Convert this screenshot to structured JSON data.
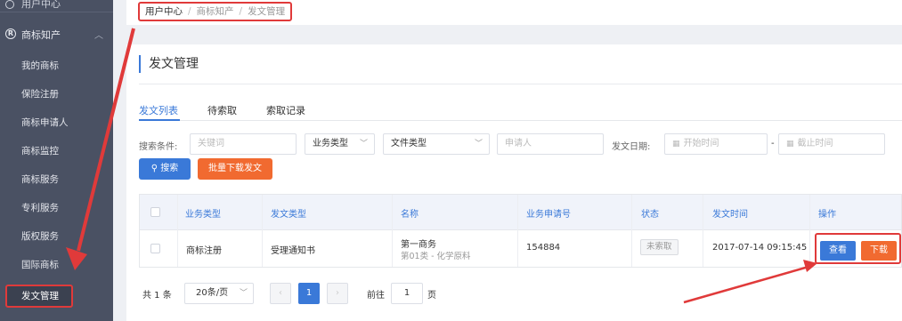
{
  "sidebar": {
    "top_item": "用户中心",
    "group_label": "商标知产",
    "items": [
      "我的商标",
      "保险注册",
      "商标申请人",
      "商标监控",
      "商标服务",
      "专利服务",
      "版权服务",
      "国际商标",
      "发文管理"
    ]
  },
  "breadcrumb": [
    "用户中心",
    "商标知产",
    "发文管理"
  ],
  "page_title": "发文管理",
  "tabs": [
    "发文列表",
    "待索取",
    "索取记录"
  ],
  "filters": {
    "label": "搜索条件:",
    "keyword_placeholder": "关键词",
    "business_type": "业务类型",
    "doc_type": "文件类型",
    "applicant_placeholder": "申请人",
    "date_label": "发文日期:",
    "start_placeholder": "开始时间",
    "end_placeholder": "截止时间",
    "search_button": "搜索",
    "batch_button": "批量下载发文"
  },
  "table": {
    "headers": [
      "业务类型",
      "发文类型",
      "名称",
      "业务申请号",
      "状态",
      "发文时间",
      "操作"
    ],
    "rows": [
      {
        "business_type": "商标注册",
        "doc_type": "受理通知书",
        "name": "第一商务",
        "name_sub": "第01类 - 化学原料",
        "app_no": "154884",
        "status": "未索取",
        "time": "2017-07-14 09:15:45",
        "view": "查看",
        "download": "下载"
      }
    ]
  },
  "pager": {
    "total": "共 1 条",
    "page_size": "20条/页",
    "prev": "‹",
    "next": "›",
    "current": "1",
    "goto_label": "前往",
    "goto_value": "1",
    "page_suffix": "页"
  },
  "colors": {
    "accent": "#3a79d8",
    "orange": "#f16a30",
    "annotation_red": "#e03a3a",
    "sidebar": "#4a5163"
  }
}
